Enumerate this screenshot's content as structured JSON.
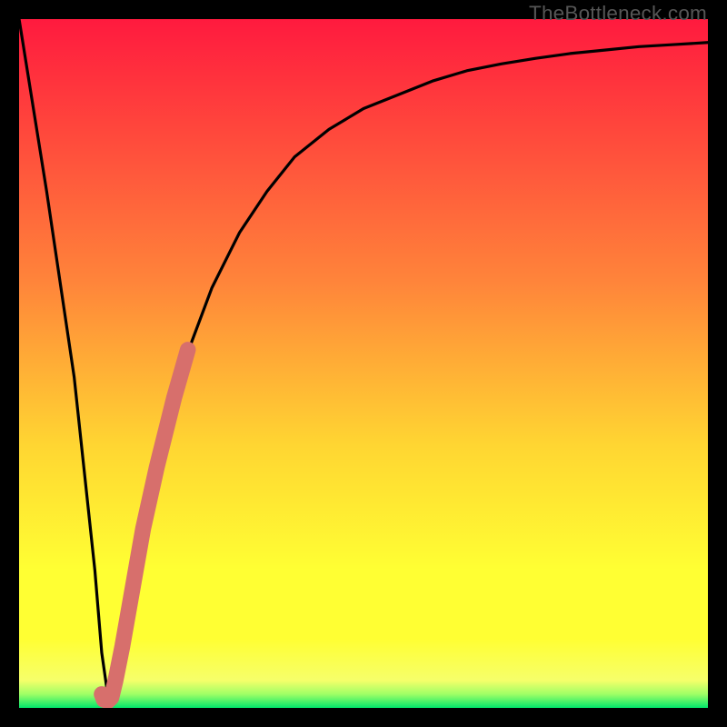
{
  "watermark": "TheBottleneck.com",
  "colors": {
    "gradient_top": "#ff1a3e",
    "gradient_mid1": "#ff843a",
    "gradient_mid2": "#ffd632",
    "gradient_mid3": "#ffff33",
    "gradient_mid4": "#f6ff6a",
    "gradient_bottom": "#00e66a",
    "curve": "#000000",
    "overlay": "#d76f6c",
    "frame": "#000000"
  },
  "chart_data": {
    "type": "line",
    "title": "",
    "xlabel": "",
    "ylabel": "",
    "xlim": [
      0,
      100
    ],
    "ylim": [
      0,
      100
    ],
    "series": [
      {
        "name": "bottleneck-curve",
        "x": [
          0,
          4,
          8,
          11,
          12,
          13,
          14,
          16,
          18,
          20,
          22,
          25,
          28,
          32,
          36,
          40,
          45,
          50,
          55,
          60,
          65,
          70,
          75,
          80,
          85,
          90,
          95,
          100
        ],
        "values": [
          100,
          75,
          48,
          20,
          8,
          1,
          4,
          15,
          26,
          35,
          43,
          53,
          61,
          69,
          75,
          80,
          84,
          87,
          89,
          91,
          92.5,
          93.5,
          94.3,
          95,
          95.5,
          96,
          96.3,
          96.6
        ]
      },
      {
        "name": "highlight-segment",
        "x": [
          12.0,
          12.3,
          12.9,
          13.4,
          14.0,
          15.0,
          16.5,
          18.0,
          20.0,
          22.5,
          24.5
        ],
        "values": [
          2.0,
          1.2,
          1.0,
          1.5,
          4.0,
          9.0,
          17.5,
          26.0,
          35.0,
          45.0,
          52.0
        ]
      }
    ],
    "gradient_stops_pct": [
      0,
      38,
      62,
      80,
      90,
      96,
      98,
      100
    ]
  }
}
